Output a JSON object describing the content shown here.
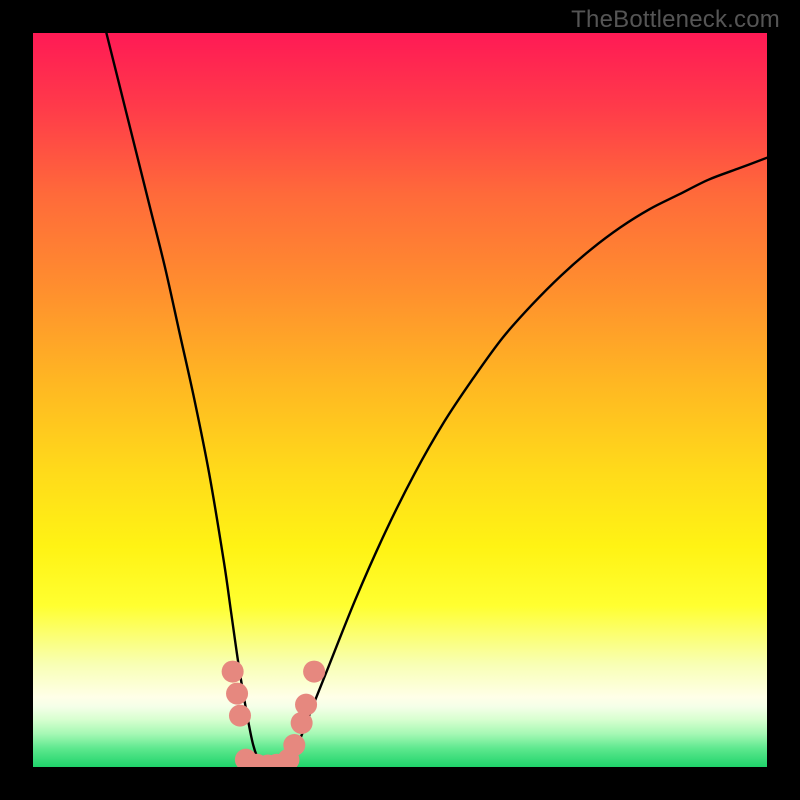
{
  "watermark": "TheBottleneck.com",
  "colors": {
    "page_bg": "#000000",
    "watermark_text": "#555555",
    "curve": "#000000",
    "marker_fill": "#e6887f",
    "marker_stroke": "#c76f66",
    "gradient_stops": [
      {
        "offset": 0.0,
        "color": "#ff1a55"
      },
      {
        "offset": 0.1,
        "color": "#ff3a4a"
      },
      {
        "offset": 0.22,
        "color": "#ff6a3a"
      },
      {
        "offset": 0.35,
        "color": "#ff8f2e"
      },
      {
        "offset": 0.48,
        "color": "#ffb822"
      },
      {
        "offset": 0.6,
        "color": "#ffdb1a"
      },
      {
        "offset": 0.7,
        "color": "#fff314"
      },
      {
        "offset": 0.78,
        "color": "#ffff30"
      },
      {
        "offset": 0.86,
        "color": "#f8ffb4"
      },
      {
        "offset": 0.905,
        "color": "#ffffe8"
      },
      {
        "offset": 0.918,
        "color": "#f4ffe8"
      },
      {
        "offset": 0.935,
        "color": "#d8ffd0"
      },
      {
        "offset": 0.955,
        "color": "#a5f8b4"
      },
      {
        "offset": 0.975,
        "color": "#5de88e"
      },
      {
        "offset": 1.0,
        "color": "#1fd36a"
      }
    ]
  },
  "chart_data": {
    "type": "line",
    "title": "",
    "xlabel": "",
    "ylabel": "",
    "xlim": [
      0,
      100
    ],
    "ylim": [
      0,
      100
    ],
    "series": [
      {
        "name": "bottleneck-curve",
        "x": [
          10,
          12,
          14,
          16,
          18,
          20,
          22,
          24,
          26,
          27,
          28,
          29,
          30,
          31,
          32,
          33,
          34,
          36,
          38,
          40,
          44,
          48,
          52,
          56,
          60,
          64,
          68,
          72,
          76,
          80,
          84,
          88,
          92,
          96,
          100
        ],
        "y": [
          100,
          92,
          84,
          76,
          68,
          59,
          50,
          40,
          28,
          21,
          14,
          8,
          3,
          0.5,
          0,
          0,
          0.5,
          3,
          8,
          13,
          23,
          32,
          40,
          47,
          53,
          58.5,
          63,
          67,
          70.5,
          73.5,
          76,
          78,
          80,
          81.5,
          83
        ]
      }
    ],
    "markers": {
      "name": "highlighted-points",
      "points": [
        {
          "x": 27.2,
          "y": 13.0
        },
        {
          "x": 27.8,
          "y": 10.0
        },
        {
          "x": 28.2,
          "y": 7.0
        },
        {
          "x": 29.0,
          "y": 1.0
        },
        {
          "x": 30.5,
          "y": 0.3
        },
        {
          "x": 32.0,
          "y": 0.2
        },
        {
          "x": 33.2,
          "y": 0.3
        },
        {
          "x": 34.8,
          "y": 1.0
        },
        {
          "x": 35.6,
          "y": 3.0
        },
        {
          "x": 36.6,
          "y": 6.0
        },
        {
          "x": 37.2,
          "y": 8.5
        },
        {
          "x": 38.3,
          "y": 13.0
        }
      ]
    }
  }
}
